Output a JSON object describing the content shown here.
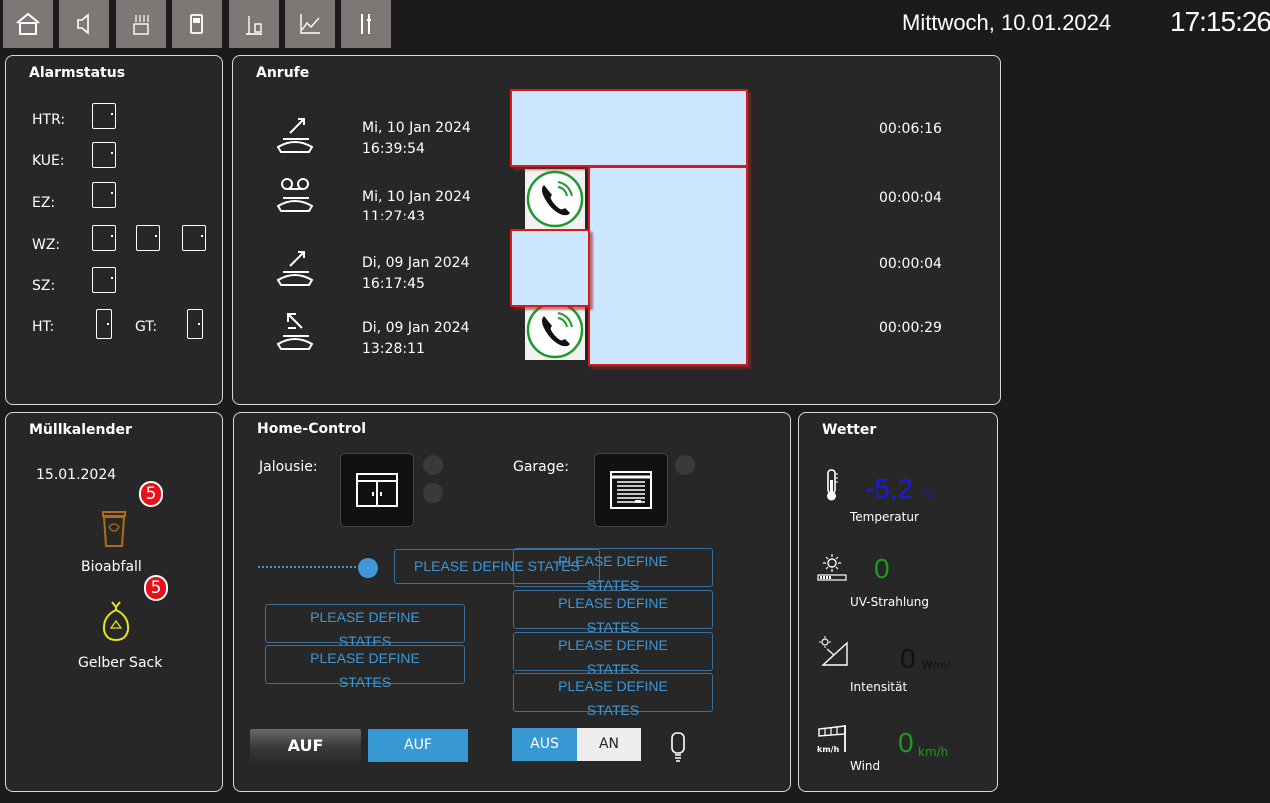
{
  "header": {
    "date": "Mittwoch, 10.01.2024",
    "time": "17:15:26"
  },
  "nav": [
    "home-icon",
    "speaker-icon",
    "heating-icon",
    "fuel-icon",
    "tank-level-icon",
    "chart-icon",
    "tools-icon"
  ],
  "alarm": {
    "title": "Alarmstatus",
    "rows": [
      "HTR:",
      "KUE:",
      "EZ:",
      "WZ:",
      "SZ:"
    ],
    "ht_label": "HT:",
    "gt_label": "GT:"
  },
  "calls": {
    "title": "Anrufe",
    "entries": [
      {
        "date": "Mi, 10 Jan 2024",
        "time": "16:39:54",
        "duration": "00:06:16",
        "icon": "outgoing-call-icon"
      },
      {
        "date": "Mi, 10 Jan 2024",
        "time": "11:27:43",
        "duration": "00:00:04",
        "icon": "voicemail-icon"
      },
      {
        "date": "Di, 09 Jan 2024",
        "time": "16:17:45",
        "duration": "00:00:04",
        "icon": "outgoing-call-icon"
      },
      {
        "date": "Di, 09 Jan 2024",
        "time": "13:28:11",
        "duration": "00:00:29",
        "icon": "incoming-call-icon"
      }
    ]
  },
  "trash": {
    "title": "Müllkalender",
    "date": "15.01.2024",
    "items": [
      {
        "label": "Bioabfall",
        "badge": "5",
        "color": "#b46a17"
      },
      {
        "label": "Gelber Sack",
        "badge": "5",
        "color": "#e6e21c"
      }
    ]
  },
  "home": {
    "title": "Home-Control",
    "jalousie_label": "Jalousie:",
    "garage_label": "Garage:",
    "slider_value_percent": 100,
    "pds_line1": "PLEASE DEFINE",
    "pds_line2": "STATES",
    "pds_single": "PLEASE DEFINE STATES",
    "btn_auf_dark": "AUF",
    "btn_auf_blue": "AUF",
    "btn_aus": "AUS",
    "btn_an": "AN"
  },
  "weather": {
    "title": "Wetter",
    "temperature": {
      "value": "-5,2",
      "unit": "°C",
      "label": "Temperatur",
      "color": "#1a1ae8"
    },
    "uv": {
      "value": "0",
      "label": "UV-Strahlung",
      "color": "#1f9a1f"
    },
    "intensity": {
      "value": "0",
      "unit": "W/m²",
      "label": "Intensität",
      "color": "#111111"
    },
    "wind": {
      "value": "0",
      "unit": "km/h",
      "label": "Wind",
      "icon_text": "km/h",
      "color": "#1f9a1f"
    }
  }
}
